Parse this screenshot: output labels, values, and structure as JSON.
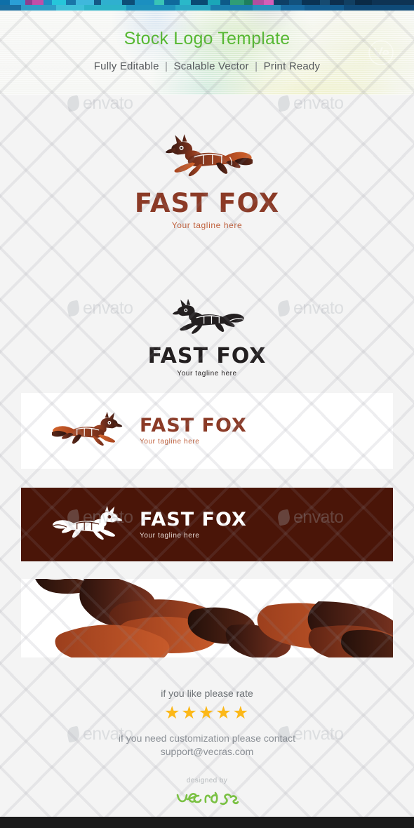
{
  "header": {
    "title": "Stock Logo Template",
    "features": [
      "Fully Editable",
      "Scalable Vector",
      "Print Ready"
    ],
    "separator": "|",
    "title_color": "#56b832",
    "subtitle_color": "#55585c",
    "badge_icon": "ve-circle-watermark-icon"
  },
  "watermark": {
    "text": "envato",
    "icon": "envato-leaf-icon"
  },
  "logo": {
    "name": "FAST FOX",
    "tagline": "Your tagline here",
    "icon": "running-fox-icon",
    "colors": {
      "wordmark_brown": "#8b3a26",
      "tagline_orange": "#c0603c",
      "fox_dark": "#4a2018",
      "fox_mid": "#8b3a22",
      "fox_light": "#c4572a",
      "black": "#231f20",
      "banner_dark_bg": "#4a1508",
      "banner_white_bg": "#ffffff"
    }
  },
  "variants": [
    {
      "id": "color-stacked",
      "label": "FAST FOX",
      "tagline": "Your tagline here"
    },
    {
      "id": "black-stacked",
      "label": "FAST FOX",
      "tagline": "Your tagline here"
    },
    {
      "id": "horizontal-light",
      "label": "FAST FOX",
      "tagline": "Your tagline here"
    },
    {
      "id": "horizontal-dark",
      "label": "FAST FOX",
      "tagline": "Your tagline here"
    },
    {
      "id": "zoom-detail",
      "label": "",
      "tagline": ""
    }
  ],
  "footer": {
    "rate_label": "if you like please rate",
    "stars": "★★★★★",
    "star_count": 5,
    "star_color": "#fcb818",
    "contact_line1": "if you need customization please contact",
    "contact_line2": "support@vecras.com",
    "designed_by": "designed by",
    "brand": "vecras",
    "brand_color": "#7ac143"
  }
}
